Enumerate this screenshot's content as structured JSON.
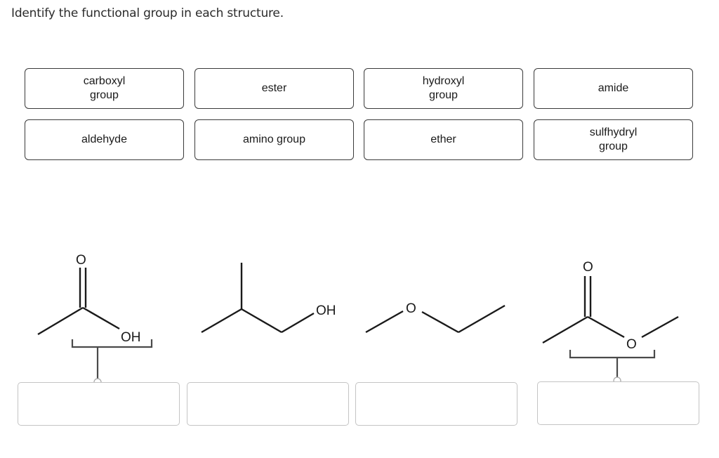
{
  "prompt": "Identify the functional group in each structure.",
  "answer_tiles": [
    {
      "label": "carboxyl\ngroup"
    },
    {
      "label": "ester"
    },
    {
      "label": "hydroxyl\ngroup"
    },
    {
      "label": "amide"
    },
    {
      "label": "aldehyde"
    },
    {
      "label": "amino group"
    },
    {
      "label": "ether"
    },
    {
      "label": "sulfhydryl\ngroup"
    }
  ],
  "structures": [
    {
      "name": "carboxylic-acid",
      "atom_labels": [
        "O",
        "OH"
      ],
      "has_bracket": true,
      "drop_value": ""
    },
    {
      "name": "alcohol",
      "atom_labels": [
        "OH"
      ],
      "has_bracket": false,
      "drop_value": ""
    },
    {
      "name": "ether-compound",
      "atom_labels": [
        "O"
      ],
      "has_bracket": false,
      "drop_value": ""
    },
    {
      "name": "ester-compound",
      "atom_labels": [
        "O",
        "O"
      ],
      "has_bracket": true,
      "drop_value": ""
    }
  ],
  "colors": {
    "tile_border": "#3a3a3a",
    "drop_border": "#c4c4c4",
    "bond": "#1a1a1a",
    "bracket": "#4a4a4a"
  }
}
